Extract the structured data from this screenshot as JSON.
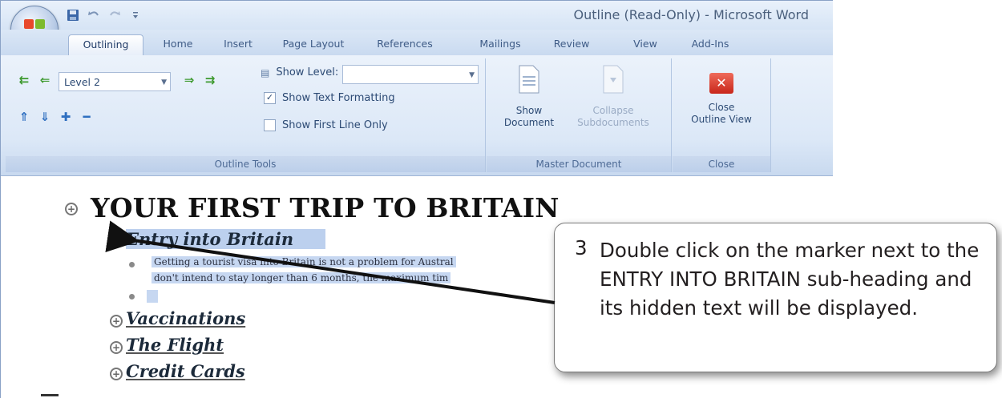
{
  "window": {
    "title": "Outline (Read-Only) - Microsoft Word"
  },
  "quick_access": {
    "items": [
      "save-icon",
      "undo-icon",
      "redo-icon",
      "customize-icon"
    ]
  },
  "tabs": [
    "Outlining",
    "Home",
    "Insert",
    "Page Layout",
    "References",
    "Mailings",
    "Review",
    "View",
    "Add-Ins"
  ],
  "active_tab": "Outlining",
  "ribbon": {
    "outline_tools": {
      "label": "Outline Tools",
      "level_value": "Level 2",
      "show_level_label": "Show Level:",
      "show_level_value": "",
      "show_text_formatting_label": "Show Text Formatting",
      "show_text_formatting_checked": true,
      "show_first_line_only_label": "Show First Line Only",
      "show_first_line_only_checked": false
    },
    "master_document": {
      "label": "Master Document",
      "show_document_line1": "Show",
      "show_document_line2": "Document",
      "collapse_subdocuments_line1": "Collapse",
      "collapse_subdocuments_line2": "Subdocuments"
    },
    "close": {
      "label": "Close",
      "close_outline_line1": "Close",
      "close_outline_line2": "Outline View"
    }
  },
  "document": {
    "heading1": "YOUR FIRST TRIP TO BRITAIN",
    "entry_heading": "Entry into Britain",
    "body_line1": "Getting a tourist visa into Britain is not a problem for Austral",
    "body_line2": "don't intend to stay longer than 6 months, the maximum tim",
    "vaccinations": "Vaccinations",
    "flight": "The Flight",
    "credit_cards": "Credit Cards"
  },
  "callout": {
    "number": "3",
    "text": "Double click on the marker next to the ENTRY INTO BRITAIN sub-heading and its hidden text will be displayed."
  },
  "colors": {
    "selection": "#bcd0ee",
    "ribbon": "#dce8f7",
    "close_button": "#d9372c"
  }
}
